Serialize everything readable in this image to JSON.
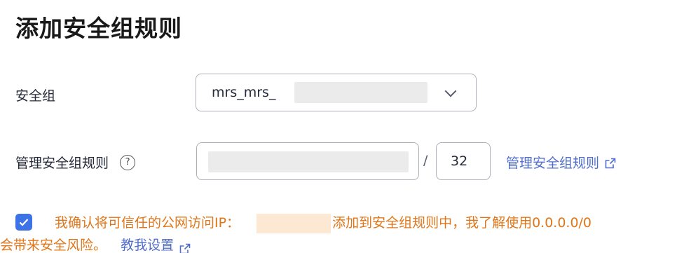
{
  "page": {
    "title": "添加安全组规则"
  },
  "security_group": {
    "label": "安全组",
    "selected_value": "mrs_mrs_"
  },
  "manage_rules": {
    "label": "管理安全组规则",
    "help_icon": "?",
    "ip_value": "",
    "slash": "/",
    "mask_value": "32",
    "link_label": "管理安全组规则"
  },
  "confirm": {
    "checked": true,
    "text_part1": "我确认将可信任的公网访问IP：",
    "text_part2": "添加到安全组规则中，我了解使用0.0.0.0/0",
    "text_line2": "会带来安全风险。",
    "teach_link": "教我设置"
  },
  "colors": {
    "accent": "#3d73e6",
    "link": "#526ecc",
    "warning": "#e0761a"
  }
}
